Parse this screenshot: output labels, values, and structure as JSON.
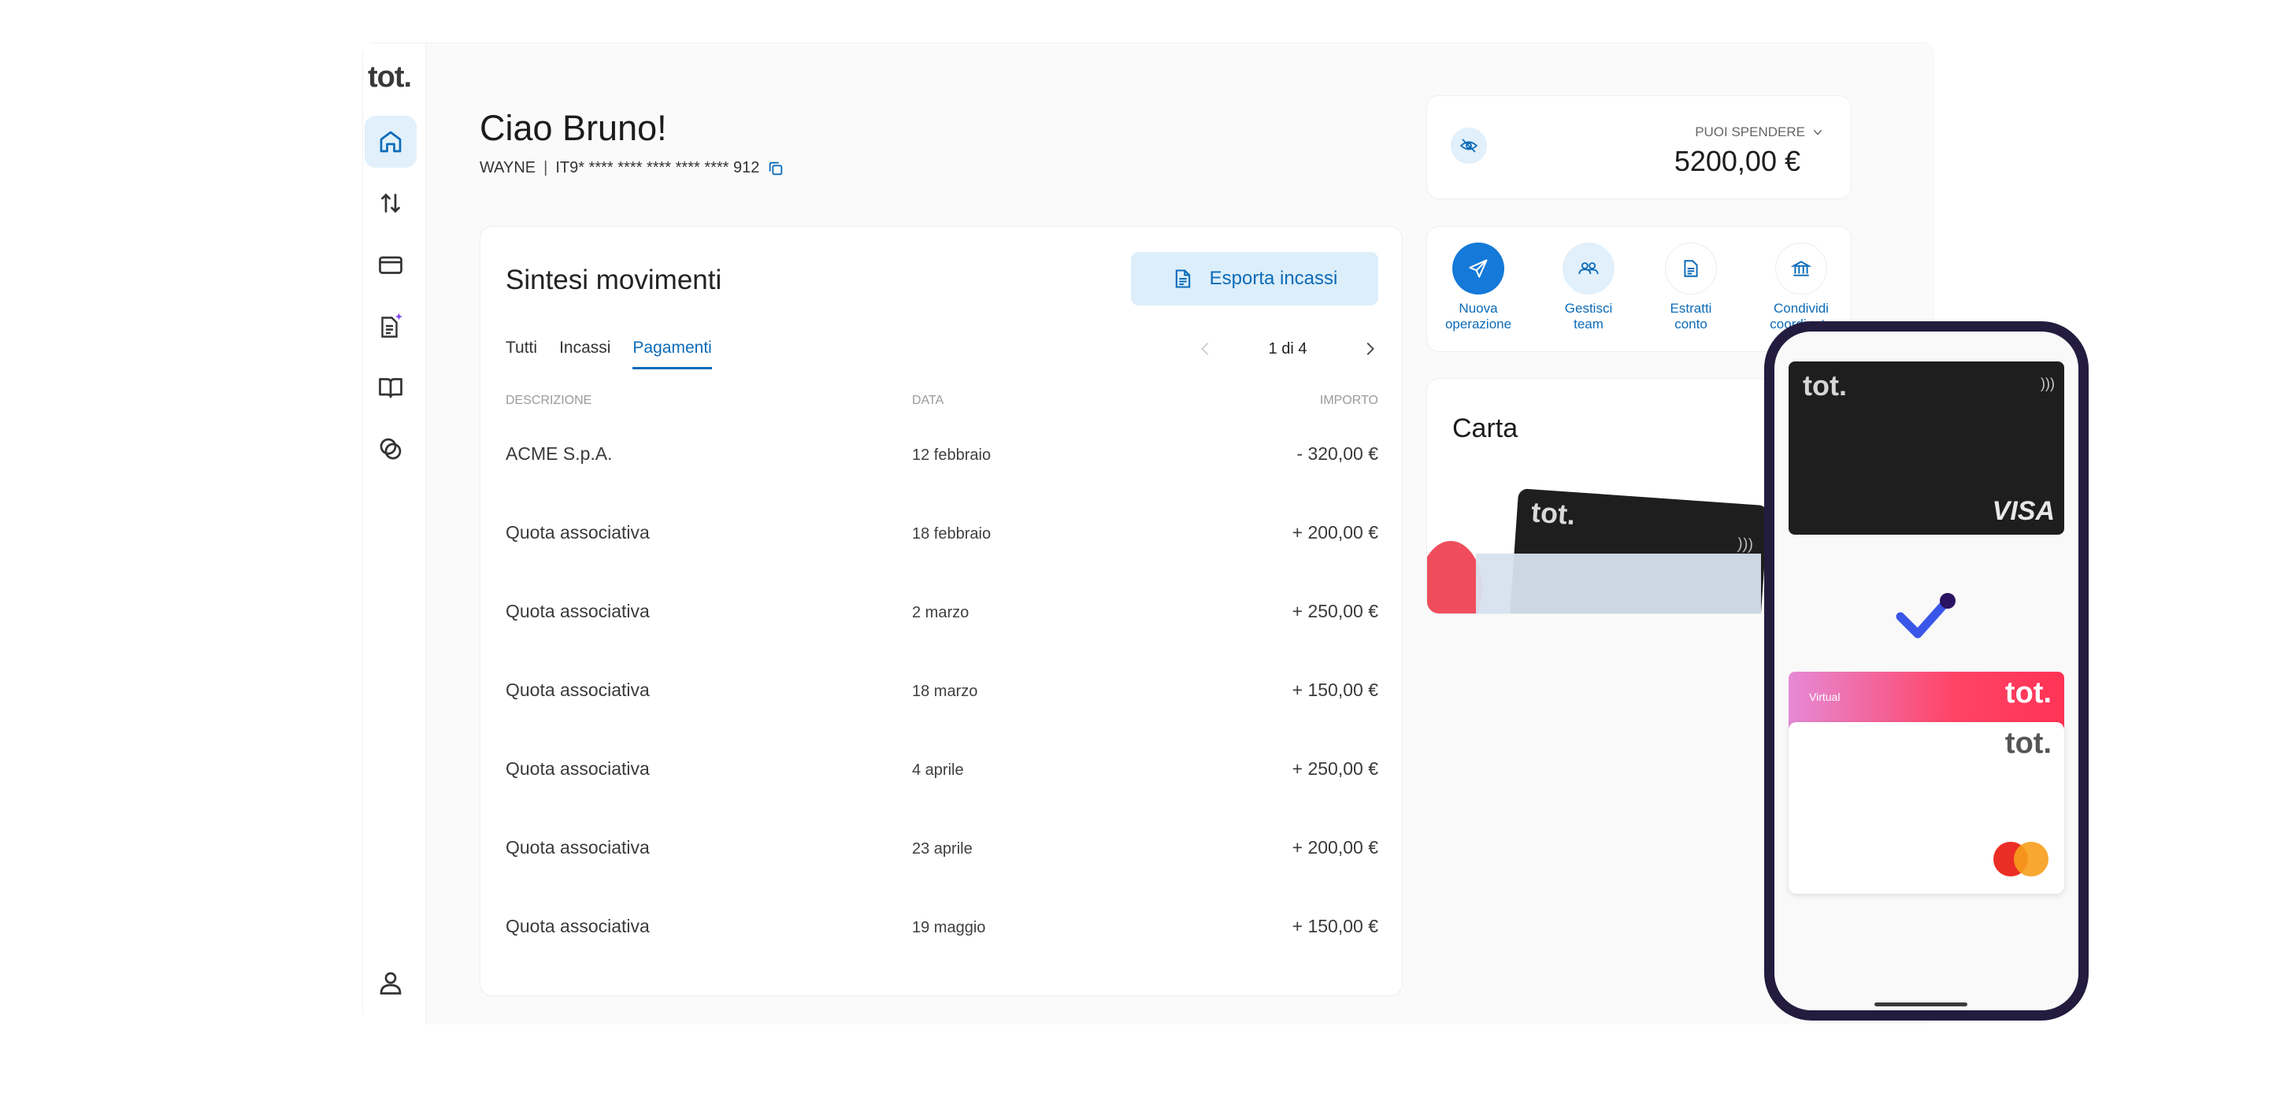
{
  "sidebar": {
    "logo": "tot.",
    "nav": [
      "home-icon",
      "transfer-icon",
      "card-icon",
      "document-sparkle-icon",
      "book-icon",
      "circles-icon"
    ],
    "footer_icon": "user-icon"
  },
  "header": {
    "greeting": "Ciao Bruno!",
    "company": "WAYNE",
    "separator": "|",
    "iban": "IT9* **** **** **** **** **** 912"
  },
  "movements": {
    "title": "Sintesi movimenti",
    "export_label": "Esporta incassi",
    "tabs": [
      {
        "label": "Tutti"
      },
      {
        "label": "Incassi"
      },
      {
        "label": "Pagamenti"
      }
    ],
    "active_tab": "Pagamenti",
    "pager": "1 di 4",
    "columns": {
      "description": "DESCRIZIONE",
      "date": "DATA",
      "amount": "IMPORTO"
    },
    "rows": [
      {
        "description": "ACME S.p.A.",
        "date": "12 febbraio",
        "amount": "- 320,00 €"
      },
      {
        "description": "Quota associativa",
        "date": "18 febbraio",
        "amount": "+ 200,00 €"
      },
      {
        "description": "Quota associativa",
        "date": "2 marzo",
        "amount": "+ 250,00 €"
      },
      {
        "description": "Quota associativa",
        "date": "18 marzo",
        "amount": "+ 150,00 €"
      },
      {
        "description": "Quota associativa",
        "date": "4 aprile",
        "amount": "+ 250,00 €"
      },
      {
        "description": "Quota associativa",
        "date": "23 aprile",
        "amount": "+ 200,00 €"
      },
      {
        "description": "Quota associativa",
        "date": "19 maggio",
        "amount": "+ 150,00 €"
      }
    ]
  },
  "balance": {
    "label": "PUOI SPENDERE",
    "value": "5200,00 €"
  },
  "quick_actions": [
    {
      "line1": "Nuova",
      "line2": "operazione",
      "icon": "send-icon"
    },
    {
      "line1": "Gestisci",
      "line2": "team",
      "icon": "team-icon"
    },
    {
      "line1": "Estratti",
      "line2": "conto",
      "icon": "statement-icon"
    },
    {
      "line1": "Condividi",
      "line2": "coordinate",
      "icon": "bank-icon"
    }
  ],
  "carta": {
    "title": "Carta",
    "card_logo": "tot."
  },
  "phone": {
    "card1_logo": "tot.",
    "card1_brand": "VISA",
    "virtual_label": "Virtual",
    "card2_logo": "tot.",
    "card3_logo": "tot."
  },
  "colors": {
    "accent": "#0c6bb8",
    "accent_light": "#dceefa",
    "phone_frame": "#231c3f",
    "card_dark": "#1e1e1e",
    "virtual_gradient_start": "#e68ad6",
    "virtual_gradient_end": "#ff4466"
  }
}
